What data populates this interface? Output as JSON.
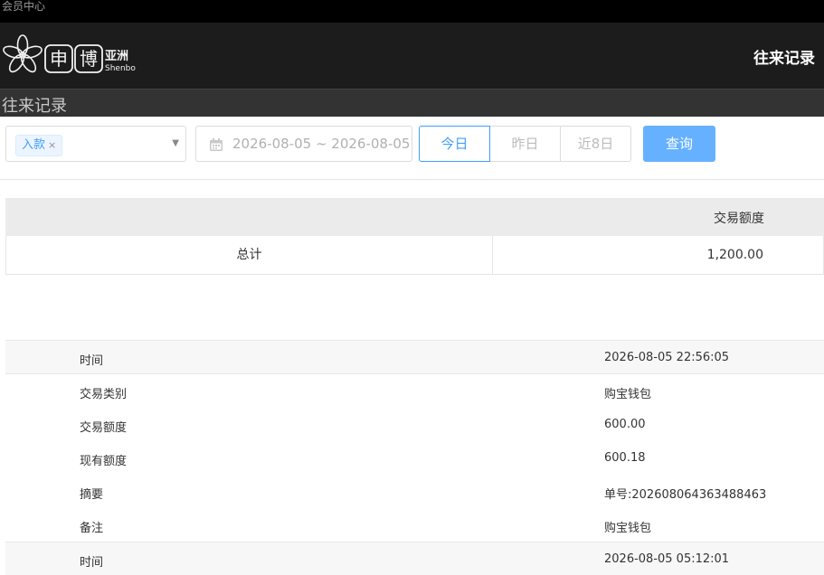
{
  "topbar": {
    "title": "会员中心"
  },
  "header": {
    "logo": {
      "cn_main_1": "申",
      "cn_main_2": "博",
      "cn_sub": "亚洲",
      "en_sub": "Shenbo"
    },
    "title": "往来记录"
  },
  "subheader": {
    "title": "往来记录"
  },
  "filters": {
    "type_tag": "入款",
    "type_tag_close": "×",
    "date_range": "2026-08-05 ~ 2026-08-05",
    "quick": [
      "今日",
      "昨日",
      "近8日"
    ],
    "search_label": "查询"
  },
  "summary": {
    "header_label": "交易额度",
    "total_label": "总计",
    "total_value": "1,200.00"
  },
  "records": [
    {
      "time_label": "时间",
      "time": "2026-08-05 22:56:05",
      "type_label": "交易类别",
      "type": "购宝钱包",
      "amount_label": "交易额度",
      "amount": "600.00",
      "balance_label": "现有额度",
      "balance": "600.18",
      "summary_label": "摘要",
      "summary": "单号:202608064363488463",
      "remark_label": "备注",
      "remark": "购宝钱包"
    },
    {
      "time_label": "时间",
      "time": "2026-08-05 05:12:01"
    }
  ],
  "colors": {
    "accent": "#409eff",
    "search_button": "#66b1ff",
    "header_bg": "#1c1c1c"
  }
}
